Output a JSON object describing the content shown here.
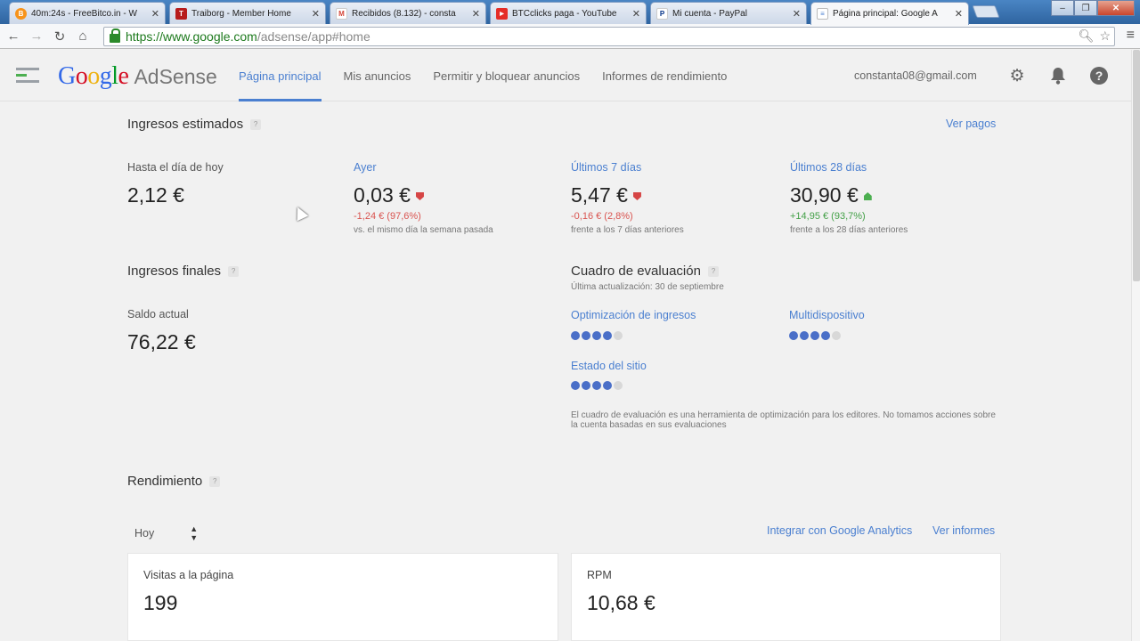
{
  "browser": {
    "tabs": [
      {
        "title": "40m:24s - FreeBitco.in - W",
        "favicon": "bitcoin-icon",
        "color": "#f7931a",
        "glyph": "B"
      },
      {
        "title": "Traiborg - Member Home",
        "favicon": "traiborg-icon",
        "color": "#b71c1c",
        "glyph": "T"
      },
      {
        "title": "Recibidos (8.132) - consta",
        "favicon": "gmail-icon",
        "color": "#d44638",
        "glyph": "M"
      },
      {
        "title": "BTCclicks paga - YouTube",
        "favicon": "youtube-icon",
        "color": "#e52d27",
        "glyph": "▶"
      },
      {
        "title": "Mi cuenta - PayPal",
        "favicon": "paypal-icon",
        "color": "#003087",
        "glyph": "P"
      },
      {
        "title": "Página principal: Google A",
        "favicon": "adsense-icon",
        "color": "#4a7fd0",
        "glyph": "≡"
      }
    ],
    "url_scheme_host": "https://www.google.com",
    "url_path": "/adsense/app#home"
  },
  "header": {
    "logo_google": "Google",
    "logo_product": "AdSense",
    "nav": [
      "Página principal",
      "Mis anuncios",
      "Permitir y bloquear anuncios",
      "Informes de rendimiento"
    ],
    "account": "constanta08@gmail.com"
  },
  "estimated": {
    "title": "Ingresos estimados",
    "ver_pagos": "Ver pagos",
    "today_label": "Hasta el día de hoy",
    "today_value": "2,12 €",
    "yesterday_label": "Ayer",
    "yesterday_value": "0,03 €",
    "yesterday_delta": "-1,24 € (97,6%)",
    "yesterday_note": "vs. el mismo día la semana pasada",
    "week_label": "Últimos 7 días",
    "week_value": "5,47 €",
    "week_delta": "-0,16 € (2,8%)",
    "week_note": "frente a los 7 días anteriores",
    "month_label": "Últimos 28 días",
    "month_value": "30,90 €",
    "month_delta": "+14,95 € (93,7%)",
    "month_note": "frente a los 28 días anteriores"
  },
  "final": {
    "title": "Ingresos finales",
    "balance_label": "Saldo actual",
    "balance_value": "76,22 €"
  },
  "scorecard": {
    "title": "Cuadro de evaluación",
    "updated": "Última actualización: 30 de septiembre",
    "revenue_opt_label": "Optimización de ingresos",
    "revenue_opt_score": 4,
    "multidevice_label": "Multidispositivo",
    "multidevice_score": 4,
    "site_status_label": "Estado del sitio",
    "site_status_score": 4,
    "max_score": 5,
    "disclaimer": "El cuadro de evaluación es una herramienta de optimización para los editores. No tomamos acciones sobre la cuenta basadas en sus evaluaciones"
  },
  "performance": {
    "title": "Rendimiento",
    "range": "Hoy",
    "analytics_link": "Integrar con Google Analytics",
    "reports_link": "Ver informes",
    "pageviews_label": "Visitas a la página",
    "pageviews_value": "199",
    "rpm_label": "RPM",
    "rpm_value": "10,68 €"
  },
  "colors": {
    "accent": "#4a7fd0",
    "negative": "#d9534f",
    "positive": "#43a047",
    "score_dot": "#4a6fc8"
  }
}
